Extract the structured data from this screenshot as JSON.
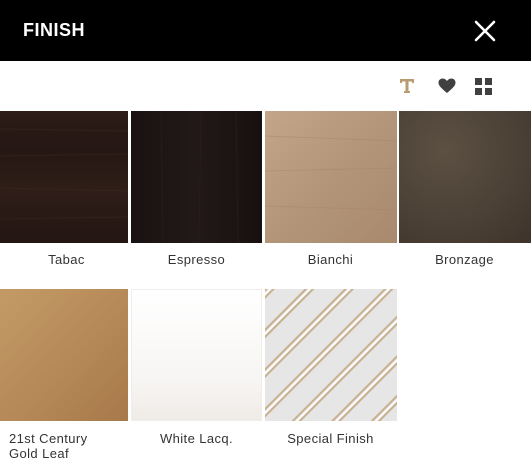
{
  "header": {
    "title": "FINISH"
  },
  "toolbar": {
    "icons": [
      "text-t-icon",
      "heart-icon",
      "grid-view-icon"
    ],
    "accent_color": "#b99b72"
  },
  "finishes": [
    {
      "label": "Tabac",
      "color": "#2a1b16"
    },
    {
      "label": "Espresso",
      "color": "#1c1414"
    },
    {
      "label": "Bianchi",
      "color": "#b5987a"
    },
    {
      "label": "Bronzage",
      "color": "#4f443a"
    },
    {
      "label": "21st Century\nGold Leaf",
      "color": "#b98d5c"
    },
    {
      "label": "White Lacq.",
      "color": "#f7f5f3"
    },
    {
      "label": "Special Finish",
      "color": "#e6e6e6"
    }
  ]
}
